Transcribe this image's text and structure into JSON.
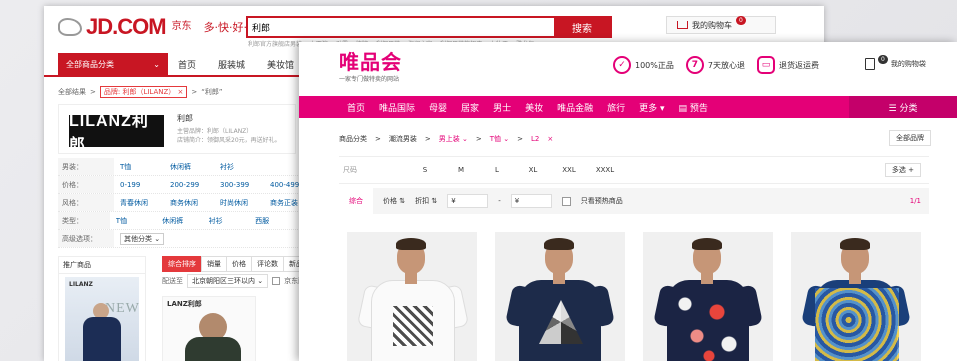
{
  "jd": {
    "logo_text": "JD.COM",
    "logo_cn": "京东",
    "slogan": "多·快·好·省",
    "search_value": "利郎",
    "search_button": "搜索",
    "hot_words": [
      "利郎官方旗舰店男装",
      "七匹狼",
      "劲霸",
      "柒牌",
      "利郎男装",
      "海澜之家",
      "利郎男装旗舰店",
      "九牧王",
      "雅戈尔"
    ],
    "cart_label": "我的购物车",
    "cart_count": "0",
    "all_categories": "全部商品分类",
    "nav": [
      "首页",
      "服装城",
      "美妆馆"
    ],
    "breadcrumb": {
      "root": "全部结果",
      "sep": ">",
      "brand_tag": "品牌: 利郎（LILANZ）",
      "close": "×",
      "query": "“利郎”"
    },
    "brand": {
      "logo": "LILANZ利郎",
      "name": "利郎",
      "info1": "主营品牌：利郎（LILANZ）",
      "info2": "店铺简介：领御风采20元，再送好礼。"
    },
    "attrs": [
      {
        "k": "男装：",
        "v": [
          "T恤",
          "休闲裤",
          "衬衫"
        ]
      },
      {
        "k": "价格：",
        "v": [
          "0-199",
          "200-299",
          "300-399",
          "400-499"
        ]
      },
      {
        "k": "风格：",
        "v": [
          "青春休闲",
          "商务休闲",
          "时尚休闲",
          "商务正装"
        ]
      },
      {
        "k": "类型：",
        "v": [
          "T恤",
          "休闲裤",
          "衬衫",
          "西服",
          "夹克"
        ]
      },
      {
        "k": "高级选项：",
        "v": [
          "其他分类 ⌄"
        ]
      }
    ],
    "promo_title": "推广商品",
    "promo_brand": "LILANZ",
    "promo_new": "NEW",
    "sort_tabs": [
      "综合排序",
      "销量",
      "价格",
      "评论数",
      "新品"
    ],
    "ship_label": "配送至",
    "ship_value": "北京朝阳区三环以内 ⌄",
    "ship_check": "京东配送",
    "product_brand": "LANZ利郎"
  },
  "vip": {
    "logo": "唯品会",
    "slogan": "一家专门做特卖的网站",
    "badges": [
      {
        "icon": "✓",
        "text": "100%正品"
      },
      {
        "icon": "7",
        "text": "7天放心退"
      },
      {
        "icon": "▭",
        "text": "退货返运费"
      }
    ],
    "cart_label": "我的购物袋",
    "cart_count": "0",
    "nav": [
      "首页",
      "唯品国际",
      "母婴",
      "居家",
      "男士",
      "美妆",
      "唯品金融",
      "旅行",
      "更多 ▾",
      "▤ 预告"
    ],
    "category_button": "☰ 分类",
    "crumbs": {
      "c1": "商品分类",
      "c2": "潮流男装",
      "c3": "男上装 ⌄",
      "c4": "T恤 ⌄",
      "c5": "L2",
      "close": "×",
      "sep": ">"
    },
    "all_brands": "全部品牌",
    "size_label": "尺码",
    "sizes": [
      "S",
      "M",
      "L",
      "XL",
      "XXL",
      "XXXL"
    ],
    "multi": "多选 +",
    "filters": {
      "default": "综合",
      "price": "价格 ⇅",
      "discount": "折扣 ⇅",
      "min": "¥",
      "dash": "-",
      "max": "¥",
      "only_sale": "只看预热商品",
      "page": "1/1"
    }
  }
}
